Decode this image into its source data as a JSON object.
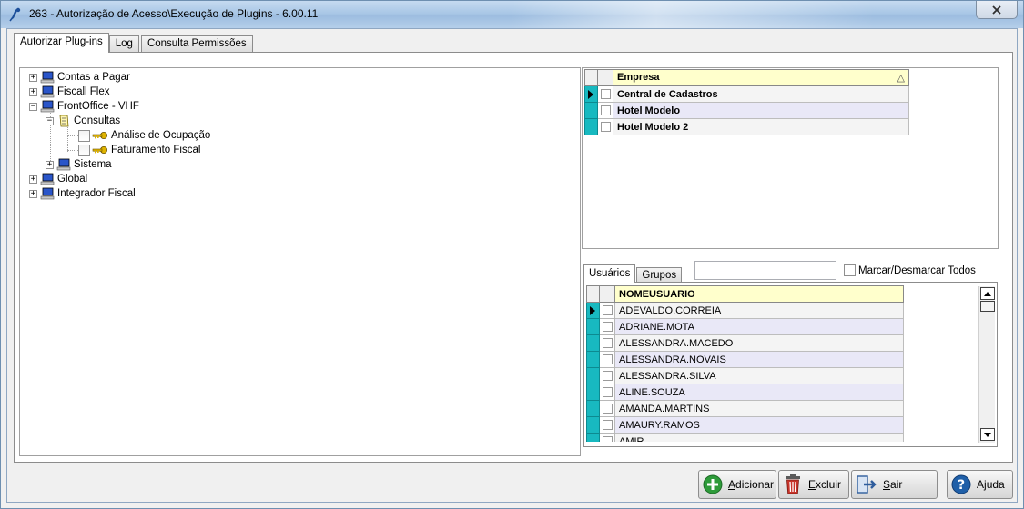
{
  "window": {
    "title": "263 - Autorização de Acesso\\Execução de Plugins - 6.00.11"
  },
  "tabs": [
    {
      "label": "Autorizar Plug-ins",
      "active": true
    },
    {
      "label": "Log",
      "active": false
    },
    {
      "label": "Consulta Permissões",
      "active": false
    }
  ],
  "tree": {
    "items": [
      {
        "label": "Contas a Pagar",
        "level": 0,
        "expander": "+",
        "icon": "computer-icon"
      },
      {
        "label": "Fiscall Flex",
        "level": 0,
        "expander": "+",
        "icon": "computer-icon"
      },
      {
        "label": "FrontOffice - VHF",
        "level": 0,
        "expander": "−",
        "icon": "computer-icon"
      },
      {
        "label": "Consultas",
        "level": 1,
        "expander": "−",
        "icon": "document-icon"
      },
      {
        "label": "Análise de Ocupação",
        "level": 2,
        "checkbox": true,
        "icon": "key-icon"
      },
      {
        "label": "Faturamento Fiscal",
        "level": 2,
        "checkbox": true,
        "icon": "key-icon"
      },
      {
        "label": "Sistema",
        "level": 1,
        "expander": "+",
        "icon": "computer-icon"
      },
      {
        "label": "Global",
        "level": 0,
        "expander": "+",
        "icon": "computer-icon"
      },
      {
        "label": "Integrador Fiscal",
        "level": 0,
        "expander": "+",
        "icon": "computer-icon"
      }
    ]
  },
  "empresa_grid": {
    "header": "Empresa",
    "sort_indicator": "△",
    "rows": [
      "Central de Cadastros",
      "Hotel Modelo",
      "Hotel Modelo 2"
    ]
  },
  "sub_tabs": [
    {
      "label": "Usuários",
      "active": true
    },
    {
      "label": "Grupos",
      "active": false
    }
  ],
  "search": {
    "value": ""
  },
  "mark_all": {
    "label": "Marcar/Desmarcar Todos"
  },
  "users_grid": {
    "header": "NOMEUSUARIO",
    "rows": [
      "ADEVALDO.CORREIA",
      "ADRIANE.MOTA",
      "ALESSANDRA.MACEDO",
      "ALESSANDRA.NOVAIS",
      "ALESSANDRA.SILVA",
      "ALINE.SOUZA",
      "AMANDA.MARTINS",
      "AMAURY.RAMOS",
      "AMIR"
    ]
  },
  "buttons": {
    "adicionar": {
      "first": "A",
      "rest": "dicionar"
    },
    "excluir": {
      "first": "E",
      "rest": "xcluir"
    },
    "sair": {
      "first": "S",
      "rest": "air"
    },
    "ajuda": {
      "first": "Aj",
      "rest": "uda",
      "underline_index": 1
    }
  },
  "colors": {
    "indicator": "#18b9c0",
    "grid_header": "#ffffcc",
    "row_alt": "#e9e8f7",
    "add_green": "#2e9b3a",
    "help_blue": "#1f5fa8"
  }
}
